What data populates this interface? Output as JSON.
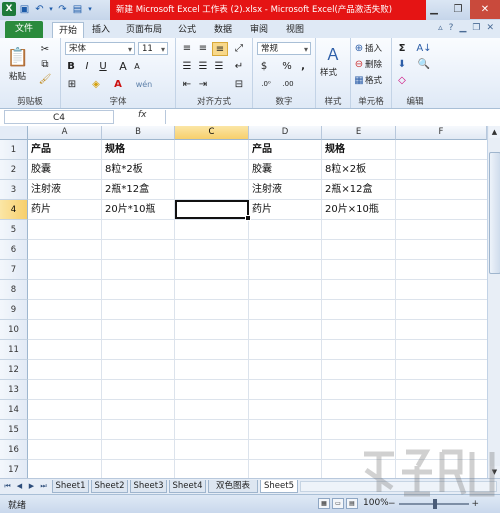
{
  "window": {
    "title": "新建 Microsoft Excel 工作表 (2).xlsx - Microsoft Excel(产品激活失败)",
    "app_icon": "X",
    "controls": [
      "minimize-icon",
      "restore-icon",
      "close-icon"
    ]
  },
  "ribbon_tabs": {
    "file": "文件",
    "tabs": [
      "开始",
      "插入",
      "页面布局",
      "公式",
      "数据",
      "审阅",
      "视图"
    ],
    "active": "开始"
  },
  "ribbon": {
    "clipboard": {
      "label": "剪贴板",
      "paste": "粘贴"
    },
    "font": {
      "label": "字体",
      "name": "宋体",
      "size": "11",
      "bold": "B",
      "italic": "I",
      "underline": "U",
      "size_up": "A",
      "size_down": "A",
      "font_color": "A",
      "wen": "wén"
    },
    "alignment": {
      "label": "对齐方式"
    },
    "number": {
      "label": "数字",
      "format": "常规",
      "percent": "%",
      "comma": ","
    },
    "styles": {
      "label": "样式",
      "button": "样式"
    },
    "cells": {
      "label": "单元格",
      "insert": "插入",
      "delete": "删除",
      "format": "格式"
    },
    "editing": {
      "label": "编辑",
      "sum": "Σ"
    }
  },
  "formula_bar": {
    "name_box": "C4",
    "fx": "fx",
    "value": ""
  },
  "sheet": {
    "columns": [
      "A",
      "B",
      "C",
      "D",
      "E",
      "F"
    ],
    "selected_column": "C",
    "rows": [
      "1",
      "2",
      "3",
      "4",
      "5",
      "6",
      "7",
      "8",
      "9",
      "10",
      "11",
      "12",
      "13",
      "14",
      "15",
      "16",
      "17"
    ],
    "selected_row": "4",
    "cells": {
      "A1": "产品",
      "B1": "规格",
      "D1": "产品",
      "E1": "规格",
      "A2": "胶囊",
      "B2": "8粒*2板",
      "D2": "胶囊",
      "E2": "8粒×2板",
      "A3": "注射液",
      "B3": "2瓶*12盒",
      "D3": "注射液",
      "E3": "2瓶×12盒",
      "A4": "药片",
      "B4": "20片*10瓶",
      "D4": "药片",
      "E4": "20片×10瓶"
    }
  },
  "sheet_tabs": [
    "Sheet1",
    "Sheet2",
    "Sheet3",
    "Sheet4",
    "双色图表",
    "Sheet5"
  ],
  "status": {
    "ready": "就绪",
    "zoom": "100%",
    "zoom_minus": "−",
    "zoom_plus": "+"
  },
  "colors": {
    "title_red": "#e51414",
    "file_tab": "#2a8b3c",
    "selected_header": "#f7cf6c"
  }
}
